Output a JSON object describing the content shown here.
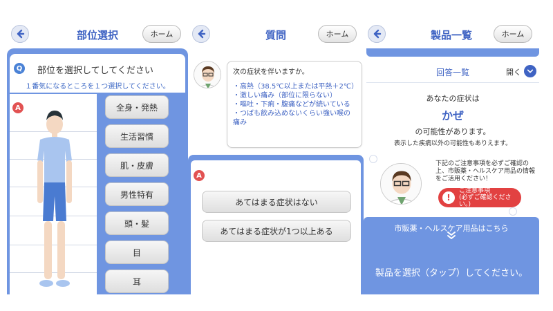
{
  "screens": {
    "body_part": {
      "header": {
        "title": "部位選択",
        "home_label": "ホーム"
      },
      "question": {
        "badge": "Q",
        "title": "部位を選択してしてください",
        "subtitle": "１番気になるところを１つ選択してください。"
      },
      "answer_badge": "A",
      "categories": [
        "全身・発熱",
        "生活習慣",
        "肌・皮膚",
        "男性特有",
        "頭・髪",
        "目",
        "耳"
      ]
    },
    "question": {
      "header": {
        "title": "質問",
        "home_label": "ホーム"
      },
      "bubble": {
        "question": "次の症状を伴いますか。",
        "symptoms": [
          "・高熱（38.5℃以上または平熱＋2℃）",
          "・激しい痛み（部位に限らない）",
          "・嘔吐・下痢・腹痛などが続いている",
          "・つばも飲み込めないくらい強い喉の痛み"
        ]
      },
      "answer_badge": "A",
      "answers": [
        "あてはまる症状はない",
        "あてはまる症状が1つ以上ある"
      ]
    },
    "products": {
      "header": {
        "title": "製品一覧",
        "home_label": "ホーム"
      },
      "results": {
        "title": "回答一覧",
        "open_label": "開く"
      },
      "result": {
        "line1": "あなたの症状は",
        "condition": "かぜ",
        "line2": "の可能性があります。",
        "note": "表示した疾病以外の可能性もありえます。"
      },
      "caution": {
        "text": "下記のご注意事項を必ずご確認の上、市販薬・ヘルスケア用品の情報をご活用ください！",
        "button_line1": "ご注意事項",
        "button_line2": "(必ずご確認ください。)"
      },
      "product_link": "市販薬・ヘルスケア用品はこちら",
      "instruction": "製品を選択（タップ）してください。"
    }
  },
  "colors": {
    "primary": "#6f95e1",
    "accent_text": "#3f63c3",
    "danger": "#e24141"
  }
}
